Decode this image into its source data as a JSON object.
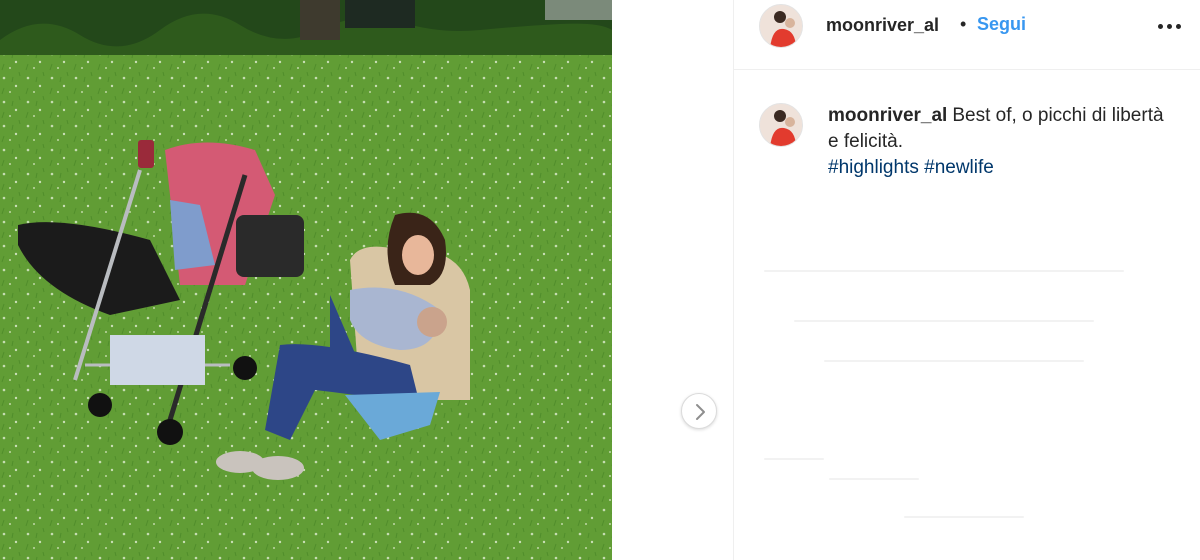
{
  "post": {
    "author": {
      "username": "moonriver_al",
      "avatar_icon": "profile-avatar-icon"
    },
    "follow_separator": "•",
    "follow_label": "Segui",
    "more_icon": "more-options-icon",
    "caption": {
      "username": "moonriver_al",
      "text": "Best of, o picchi di libertà e felicità.",
      "hashtags": [
        "#highlights",
        "#newlife"
      ]
    },
    "next_icon": "chevron-right-icon"
  },
  "colors": {
    "follow_blue": "#3897f0",
    "hashtag_blue": "#00376b",
    "text_dark": "#262626",
    "divider": "#efefef"
  }
}
